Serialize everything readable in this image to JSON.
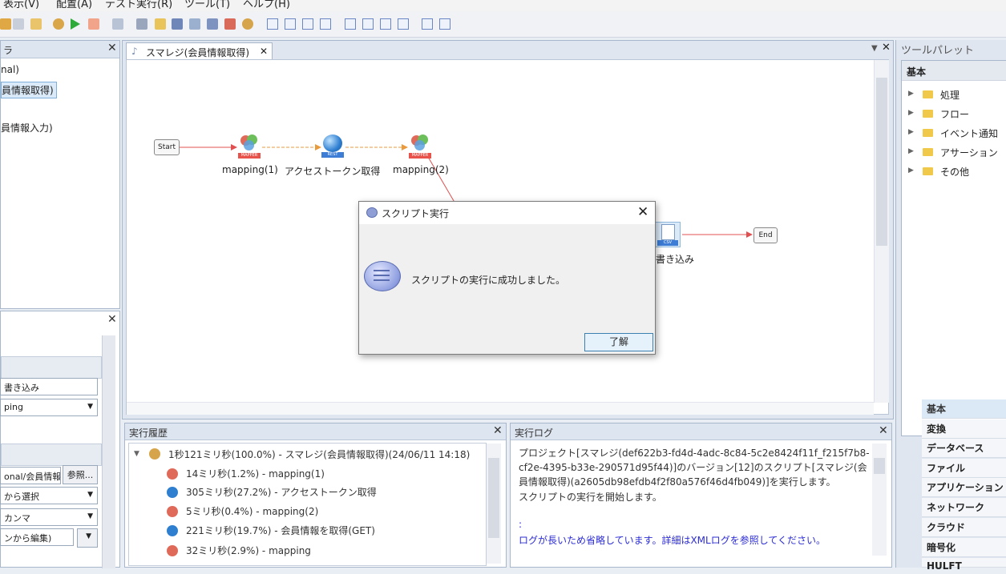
{
  "menu": [
    "表示(V)",
    "配置(A)",
    "テスト実行(R)",
    "ツール(T)",
    "ヘルプ(H)"
  ],
  "left_panel": {
    "tab_fragment": "ラ",
    "tree": [
      "nal)",
      "員情報取得)",
      "員情報入力)"
    ]
  },
  "props_panel": {
    "fields": [
      "書き込み",
      "ping",
      "onal/会員情報",
      "から選択",
      "カンマ",
      "ンから編集)"
    ],
    "browse_button": "参照..."
  },
  "editor": {
    "tab_label": "スマレジ(会員情報取得)",
    "nodes": {
      "start": "Start",
      "end": "End",
      "mapping1": "mapping(1)",
      "token": "アクセストークン取得",
      "mapping2": "mapping(2)",
      "write": "書き込み",
      "mapper_badge": "MAPPER",
      "rest_badge": "REST",
      "csv_badge": "CSV"
    }
  },
  "dialog": {
    "title": "スクリプト実行",
    "message": "スクリプトの実行に成功しました。",
    "ok_label": "了解"
  },
  "palette": {
    "title": "ツールパレット",
    "section": "基本",
    "folders": [
      "処理",
      "フロー",
      "イベント通知",
      "アサーション",
      "その他"
    ],
    "categories": [
      "基本",
      "変換",
      "データベース",
      "ファイル",
      "アプリケーション",
      "ネットワーク",
      "クラウド",
      "暗号化",
      "HULFT"
    ]
  },
  "history": {
    "title": "実行履歴",
    "root": "1秒121ミリ秒(100.0%) - スマレジ(会員情報取得)(24/06/11 14:18)",
    "rows": [
      "14ミリ秒(1.2%) - mapping(1)",
      "305ミリ秒(27.2%) - アクセストークン取得",
      "5ミリ秒(0.4%) - mapping(2)",
      "221ミリ秒(19.7%) - 会員情報を取得(GET)",
      "32ミリ秒(2.9%) - mapping"
    ]
  },
  "log": {
    "title": "実行ログ",
    "lines": [
      "プロジェクト[スマレジ(def622b3-fd4d-4adc-8c84-5c2e8424f11f_f215f7b8-",
      "cf2e-4395-b33e-290571d95f44)]のバージョン[12]のスクリプト[スマレジ(会",
      "員情報取得)(a2605db98efdb4f2f80a576f46d4fb049)]を実行します。",
      "スクリプトの実行を開始します。"
    ],
    "dots": ":",
    "omitted": "ログが長いため省略しています。詳細はXMLログを参照してください。"
  },
  "colors": {
    "accent": "#3c7fb1",
    "flow_arrow": "#e05050",
    "flow_dashed": "#e89a3c",
    "log_blue": "#2b2bd6"
  }
}
